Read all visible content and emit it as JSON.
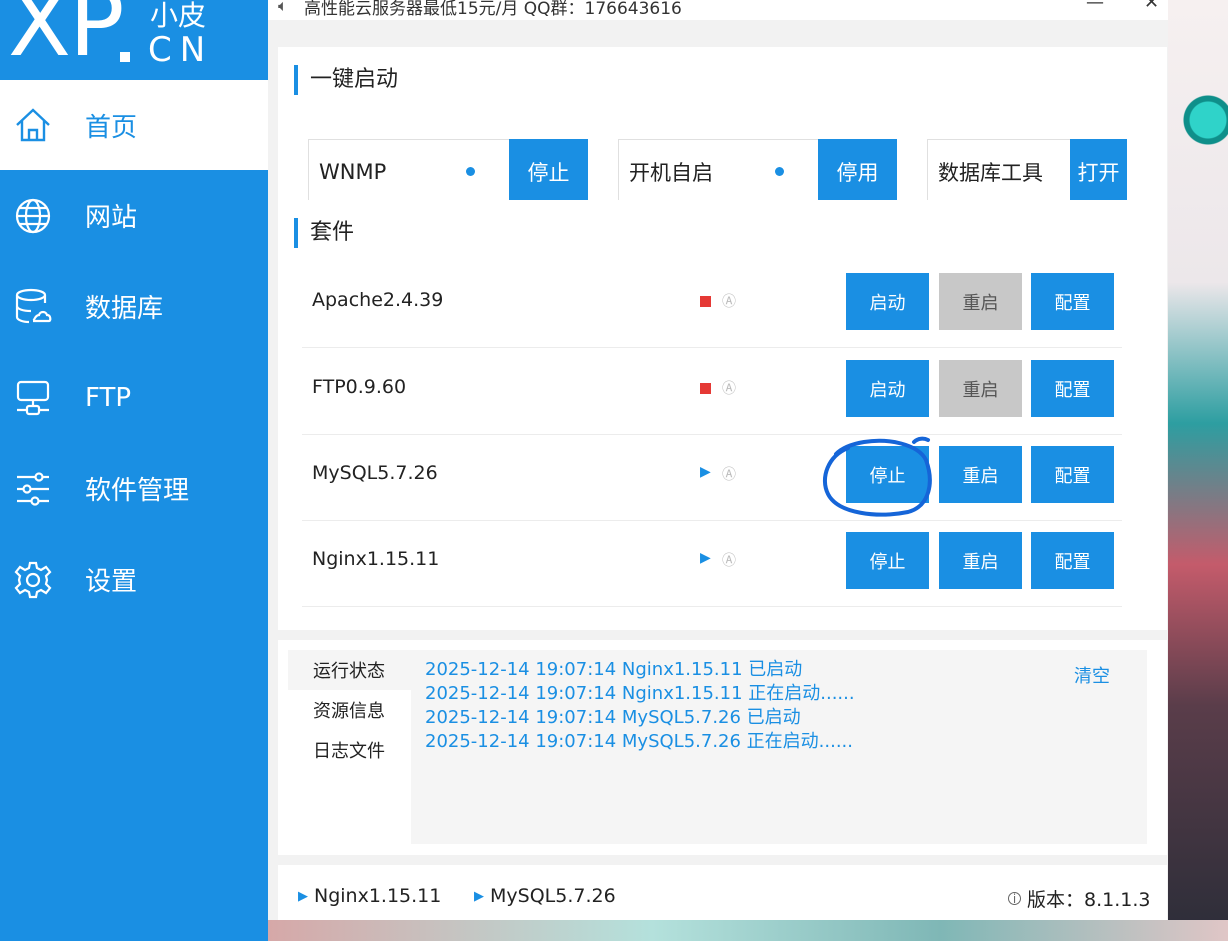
{
  "window": {
    "notice": "高性能云服务器最低15元/月  QQ群：176643616",
    "minimize": "—",
    "close": "✕"
  },
  "logo": {
    "brand": "XP",
    "top_text": "小皮",
    "sub_text": "CN"
  },
  "sidebar": {
    "items": [
      {
        "label": "首页",
        "icon": "home-icon",
        "active": true
      },
      {
        "label": "网站",
        "icon": "globe-icon",
        "active": false
      },
      {
        "label": "数据库",
        "icon": "database-icon",
        "active": false
      },
      {
        "label": "FTP",
        "icon": "server-icon",
        "active": false
      },
      {
        "label": "软件管理",
        "icon": "sliders-icon",
        "active": false
      },
      {
        "label": "设置",
        "icon": "gear-icon",
        "active": false
      }
    ]
  },
  "quick_start": {
    "title": "一键启动",
    "items": [
      {
        "label": "WNMP",
        "button": "停止"
      },
      {
        "label": "开机自启",
        "button": "停用"
      },
      {
        "label": "数据库工具",
        "button": "打开"
      }
    ]
  },
  "suite": {
    "title": "套件",
    "rows": [
      {
        "name": "Apache2.4.39",
        "state": "stopped",
        "auto": "Ⓐ",
        "action": "启动",
        "restart": "重启",
        "config": "配置"
      },
      {
        "name": "FTP0.9.60",
        "state": "stopped",
        "auto": "Ⓐ",
        "action": "启动",
        "restart": "重启",
        "config": "配置"
      },
      {
        "name": "MySQL5.7.26",
        "state": "running",
        "auto": "Ⓐ",
        "action": "停止",
        "restart": "重启",
        "config": "配置"
      },
      {
        "name": "Nginx1.15.11",
        "state": "running",
        "auto": "Ⓐ",
        "action": "停止",
        "restart": "重启",
        "config": "配置"
      }
    ]
  },
  "log": {
    "tabs": [
      "运行状态",
      "资源信息",
      "日志文件"
    ],
    "active_tab": 0,
    "clear": "清空",
    "lines": [
      "2025-12-14 19:07:14 Nginx1.15.11 已启动",
      "2025-12-14 19:07:14 Nginx1.15.11 正在启动......",
      "2025-12-14 19:07:14 MySQL5.7.26 已启动",
      "2025-12-14 19:07:14 MySQL5.7.26 正在启动......"
    ]
  },
  "statusbar": {
    "services": [
      "Nginx1.15.11",
      "MySQL5.7.26"
    ],
    "version": "版本：8.1.1.3"
  },
  "colors": {
    "accent": "#1a8fe3",
    "stopped": "#e53935",
    "disabled": "#c8c8c8",
    "annotation": "#1565d8"
  }
}
